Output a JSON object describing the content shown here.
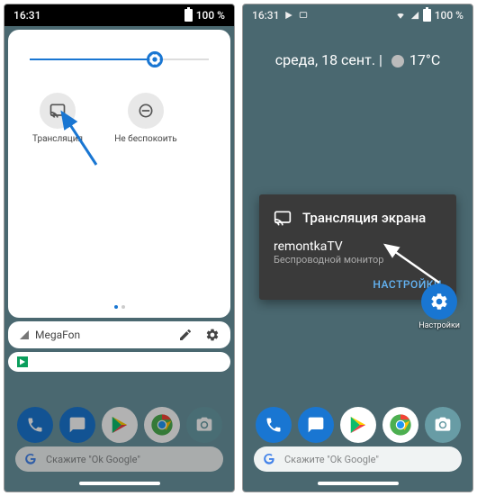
{
  "left": {
    "status": {
      "time": "16:31",
      "battery": "100 %"
    },
    "tiles": [
      {
        "name": "cast",
        "label": "Трансляция"
      },
      {
        "name": "dnd",
        "label": "Не беспокоить"
      }
    ],
    "carrier": "MegaFon"
  },
  "right": {
    "status": {
      "time": "16:31",
      "battery": "100 %"
    },
    "date": "среда, 18 сент.",
    "weather_temp": "17°C",
    "cast_dialog": {
      "title": "Трансляция экрана",
      "device": "remontkaTV",
      "subtitle": "Беспроводной монитор",
      "settings_btn": "НАСТРОЙКИ"
    },
    "shortcut_label": "Настройки",
    "search_placeholder": "Скажите \"Ok Google\""
  }
}
